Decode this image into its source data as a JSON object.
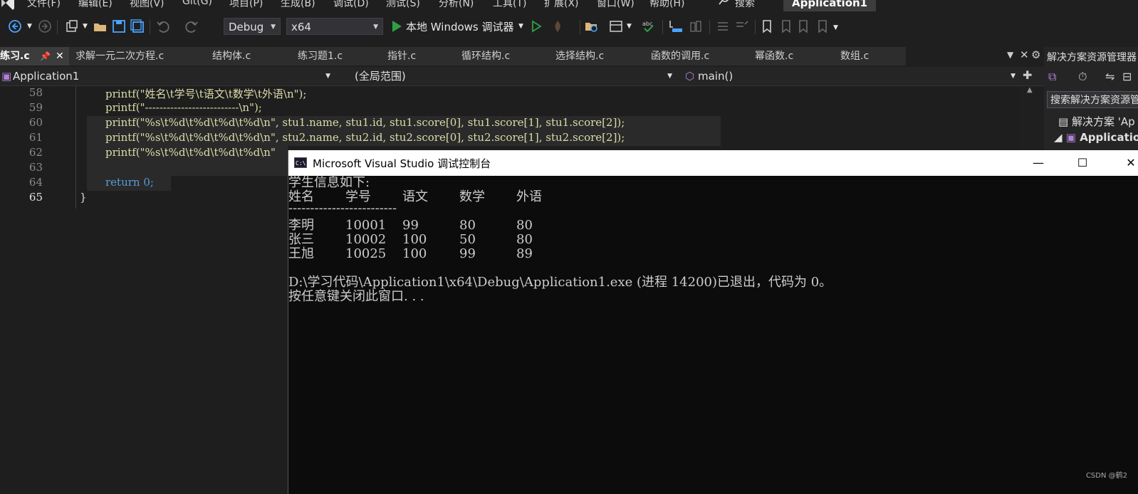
{
  "menu": {
    "items": [
      "文件(F)",
      "编辑(E)",
      "视图(V)",
      "Git(G)",
      "项目(P)",
      "生成(B)",
      "调试(D)",
      "测试(S)",
      "分析(N)",
      "工具(T)",
      "扩展(X)",
      "窗口(W)",
      "帮助(H)"
    ],
    "search_label": "搜索",
    "app_title": "Application1"
  },
  "toolbar": {
    "config": "Debug",
    "platform": "x64",
    "run_label": "本地 Windows 调试器"
  },
  "tabs": [
    {
      "label": "练习.c",
      "active": true
    },
    {
      "label": "求解一元二次方程.c"
    },
    {
      "label": "结构体.c"
    },
    {
      "label": "练习题1.c"
    },
    {
      "label": "指针.c"
    },
    {
      "label": "循环结构.c"
    },
    {
      "label": "选择结构.c"
    },
    {
      "label": "函数的调用.c"
    },
    {
      "label": "幂函数.c"
    },
    {
      "label": "数组.c"
    }
  ],
  "navbar": {
    "project": "Application1",
    "scope": "(全局范围)",
    "function": "main()"
  },
  "editor": {
    "line_numbers": [
      "58",
      "59",
      "60",
      "61",
      "62",
      "63",
      "64",
      "65"
    ],
    "lines": [
      "printf(\"姓名\\t学号\\t语文\\t数学\\t外语\\n\");",
      "printf(\"--------------------------\\n\");",
      "printf(\"%s\\t%d\\t%d\\t%d\\t%d\\n\", stu1.name, stu1.id, stu1.score[0], stu1.score[1], stu1.score[2]);",
      "printf(\"%s\\t%d\\t%d\\t%d\\t%d\\n\", stu2.name, stu2.id, stu2.score[0], stu2.score[1], stu2.score[2]);",
      "printf(\"%s\\t%d\\t%d\\t%d\\t%d\\n\"",
      "",
      "return 0;",
      "}"
    ]
  },
  "console": {
    "title": "Microsoft Visual Studio 调试控制台",
    "heading": "学生信息如下:",
    "columns": [
      "姓名",
      "学号",
      "语文",
      "数学",
      "外语"
    ],
    "divider": "-------------------------",
    "rows": [
      [
        "李明",
        "10001",
        "99",
        "80",
        "80"
      ],
      [
        "张三",
        "10002",
        "100",
        "50",
        "80"
      ],
      [
        "王旭",
        "10025",
        "100",
        "99",
        "89"
      ]
    ],
    "exit_message": "D:\\学习代码\\Application1\\x64\\Debug\\Application1.exe (进程 14200)已退出，代码为 0。",
    "close_prompt": "按任意键关闭此窗口. . ."
  },
  "solution_explorer": {
    "title": "解决方案资源管理器",
    "search_placeholder": "搜索解决方案资源管",
    "solution_item": "解决方案 'Ap",
    "project_item": "Applicatio"
  },
  "watermark": "CSDN @鹤2",
  "colors": {
    "keyword": "#569cd6",
    "string": "#d69d85",
    "variable": "#9cdcfe",
    "run_green": "#2ea043"
  }
}
